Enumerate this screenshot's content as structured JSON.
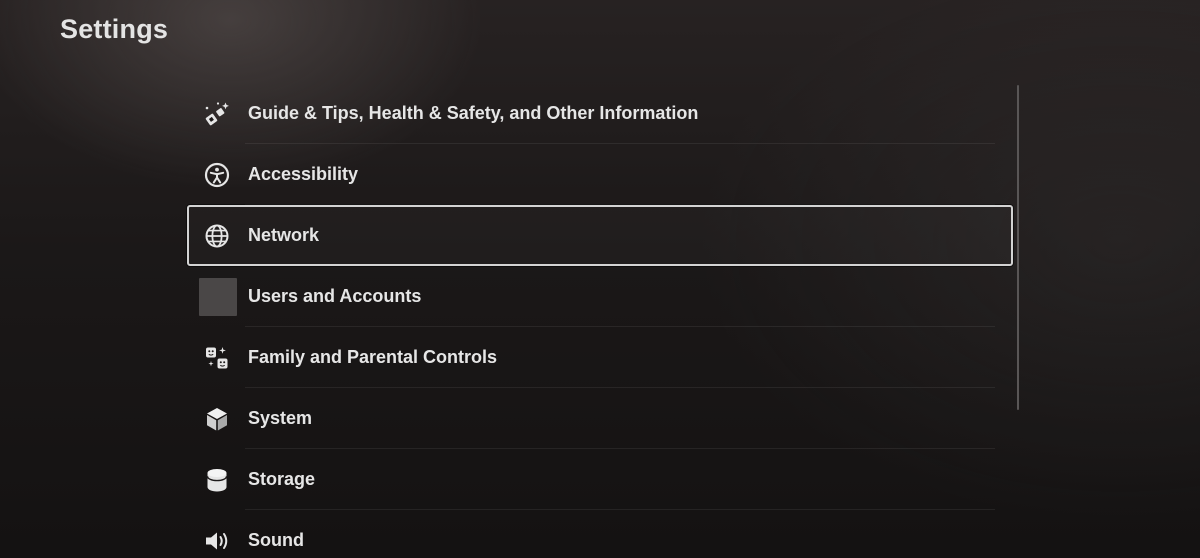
{
  "page": {
    "title": "Settings"
  },
  "menu": {
    "selected_index": 2,
    "items": [
      {
        "label": "Guide & Tips, Health & Safety, and Other Information",
        "icon": "guide-tips-icon"
      },
      {
        "label": "Accessibility",
        "icon": "accessibility-icon"
      },
      {
        "label": "Network",
        "icon": "globe-icon"
      },
      {
        "label": "Users and Accounts",
        "icon": "avatar"
      },
      {
        "label": "Family and Parental Controls",
        "icon": "family-controls-icon"
      },
      {
        "label": "System",
        "icon": "cube-icon"
      },
      {
        "label": "Storage",
        "icon": "database-icon"
      },
      {
        "label": "Sound",
        "icon": "speaker-icon"
      }
    ]
  },
  "colors": {
    "background": "#1b1818",
    "text": "#e6e6e6",
    "selection_border": "#d3d3d3"
  }
}
